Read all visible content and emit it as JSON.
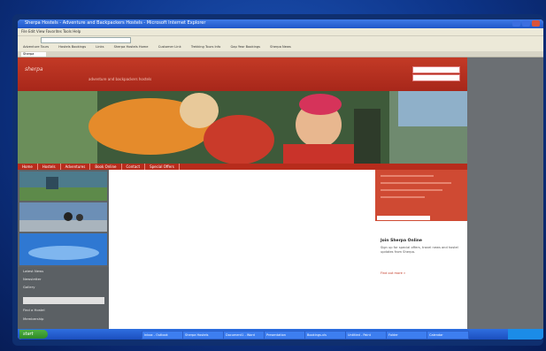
{
  "browser": {
    "title": "Sherpa Hostels - Adventure and Backpackers Hostels - Microsoft Internet Explorer",
    "menu": "File  Edit  View  Favorites  Tools  Help",
    "links": [
      "Adventure Tours",
      "Hostels Bookings",
      "Links",
      "Sherpa Hostels Home",
      "Customer Link",
      "Trekking Tours Info",
      "Gap Year Bookings",
      "Sherpa News"
    ],
    "tab_label": "Sherpa"
  },
  "site": {
    "logo": "sherpa",
    "tagline": "adventure and backpackers hostels",
    "nav": [
      "Home",
      "Hostels",
      "Adventures",
      "Book Online",
      "Contact",
      "Special Offers"
    ],
    "left_menu": [
      "Latest News",
      "Newsletter",
      "Gallery",
      "Find a Hostel",
      "Membership"
    ],
    "promo_title": "Join Sherpa Online",
    "promo_text": "Sign up for special offers, travel news and hostel updates from Sherpa.",
    "promo_link": "Find out more »"
  },
  "taskbar": {
    "start": "start",
    "tasks": [
      "Inbox - Outlook",
      "Sherpa Hostels",
      "Document1 - Word",
      "Presentation",
      "Bookings.xls",
      "Untitled - Paint",
      "Folder",
      "Calendar"
    ]
  }
}
